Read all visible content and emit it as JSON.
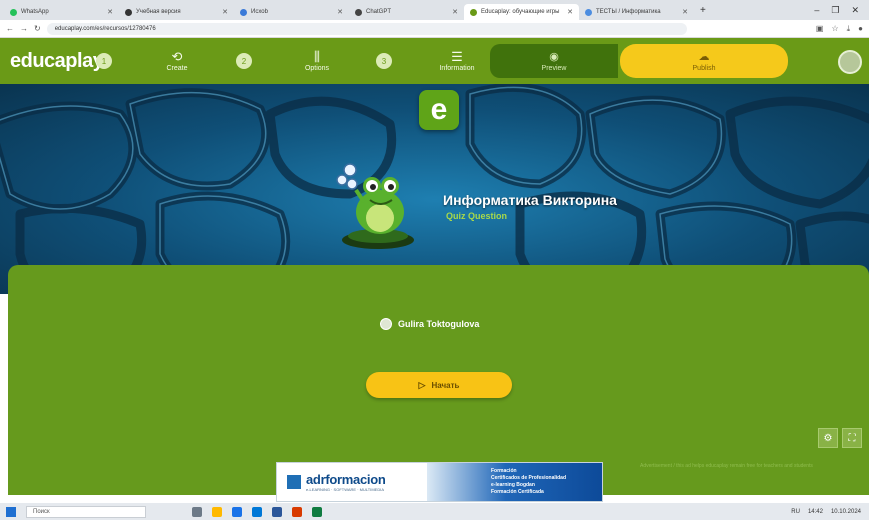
{
  "browser": {
    "tabs": [
      {
        "label": "WhatsApp",
        "icon": "whatsapp-icon",
        "active": false
      },
      {
        "label": "Учебная версия",
        "icon": "page-icon",
        "active": false
      },
      {
        "label": "Исхоb",
        "icon": "page-icon",
        "active": false
      },
      {
        "label": "ChatGPT",
        "icon": "chat-icon",
        "active": false
      },
      {
        "label": "Educaplay: обучающие игры",
        "icon": "educaplay-icon",
        "active": true
      },
      {
        "label": "ТЕСТЫ / Информатика",
        "icon": "page-icon",
        "active": false
      }
    ],
    "url": "educaplay.com/es/recursos/12780476",
    "new_tab": "+",
    "window_controls": [
      "–",
      "❐",
      "✕"
    ]
  },
  "nav": {
    "logo": "educaplay",
    "steps": [
      {
        "number": "1",
        "label": "Create",
        "icon": "⟲"
      },
      {
        "number": "2",
        "label": "Options",
        "icon": "⫼"
      },
      {
        "number": "3",
        "label": "Information",
        "icon": "☰"
      }
    ],
    "preview": {
      "label": "Preview",
      "icon": "◉"
    },
    "publish": {
      "label": "Publish",
      "icon": "☁"
    }
  },
  "hero": {
    "logo_letter": "e",
    "title": "Информатика Викторина",
    "subtitle": "Quiz Question"
  },
  "panel": {
    "author": "Gulira Toktogulova",
    "start_label": "Начать",
    "start_icon": "▷",
    "side_buttons": [
      "⚙",
      "⛶"
    ],
    "faint_note": "Advertisement / this ad helps educaplay remain free for teachers and students"
  },
  "ad": {
    "logo": "adrformacion",
    "tagline": "e-LEARNING · SOFTWARE · MULTIMEDIA",
    "lines": [
      "Formación",
      "Certificados de Profesionalidad",
      "e-learning Bogdan",
      "Formación Certificada"
    ]
  },
  "taskbar": {
    "search_placeholder": "Поиск",
    "time": "14:42",
    "date": "10.10.2024",
    "lang": "RU"
  },
  "colors": {
    "brand_green": "#6a9a17",
    "publish_yellow": "#f5c91b",
    "hero_blue": "#0f4f77"
  }
}
